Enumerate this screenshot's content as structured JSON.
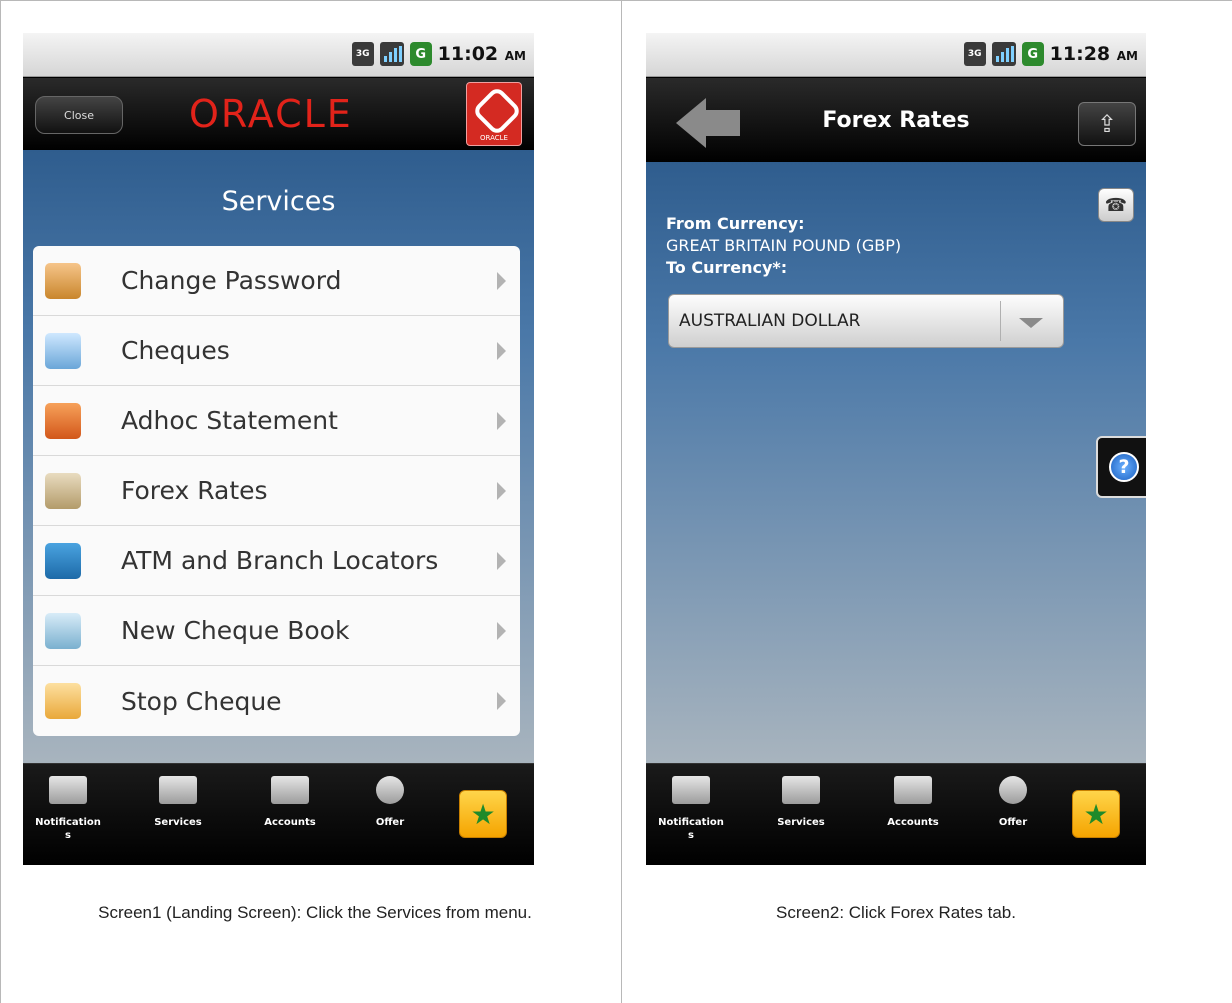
{
  "screen1": {
    "status": {
      "network": "3G",
      "battery": "G",
      "time": "11:02",
      "ampm": "AM"
    },
    "header": {
      "close_label": "Close",
      "logo_text": "ORACLE",
      "brand_mark_text": "ORACLE"
    },
    "title": "Services",
    "menu_items": [
      {
        "label": "Change Password",
        "icon": "user-lock-icon"
      },
      {
        "label": "Cheques",
        "icon": "cheque-icon"
      },
      {
        "label": "Adhoc Statement",
        "icon": "folder-icon"
      },
      {
        "label": "Forex Rates",
        "icon": "forex-icon"
      },
      {
        "label": "ATM and Branch Locators",
        "icon": "atm-icon"
      },
      {
        "label": "New Cheque Book",
        "icon": "cheque-book-icon"
      },
      {
        "label": "Stop Cheque",
        "icon": "stop-cheque-icon"
      }
    ],
    "bottom_nav": [
      {
        "label": "Notification\ns"
      },
      {
        "label": "Services"
      },
      {
        "label": "Accounts"
      },
      {
        "label": "Offer"
      }
    ]
  },
  "screen2": {
    "status": {
      "network": "3G",
      "battery": "G",
      "time": "11:28",
      "ampm": "AM"
    },
    "title": "Forex Rates",
    "from_label": "From Currency:",
    "from_value": "GREAT BRITAIN POUND (GBP)",
    "to_label": "To Currency*:",
    "to_value": "AUSTRALIAN DOLLAR",
    "help_label": "?",
    "bottom_nav": [
      {
        "label": "Notification\ns"
      },
      {
        "label": "Services"
      },
      {
        "label": "Accounts"
      },
      {
        "label": "Offer"
      }
    ]
  },
  "captions": {
    "left": "Screen1 (Landing Screen): Click the Services from menu.",
    "right": "Screen2: Click Forex Rates tab."
  },
  "colors": {
    "header_blue": "#2f5d8e",
    "oracle_red": "#e2231a",
    "fav_yellow": "#f5a400"
  }
}
